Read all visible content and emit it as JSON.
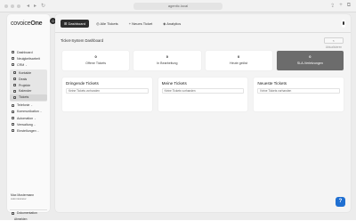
{
  "browser": {
    "url": "agentic.local",
    "nav_buttons": [
      "◂",
      "▸",
      "↻"
    ],
    "tool_buttons": [
      "⇪",
      "+",
      "⧉"
    ]
  },
  "app": {
    "logo_prefix": "co",
    "logo_middle": "voice",
    "logo_suffix": "One",
    "notification_count": "0"
  },
  "sidebar": {
    "items": [
      {
        "label": "Dashboard",
        "icon": "grid-icon"
      },
      {
        "label": "Neuigkeitsarbeit",
        "icon": "news-icon"
      },
      {
        "label": "CRM",
        "icon": "users-icon",
        "chevron": "⌄"
      }
    ],
    "crm_sub": [
      {
        "label": "Kontakte",
        "active": false
      },
      {
        "label": "Deals",
        "active": false
      },
      {
        "label": "Projekte",
        "active": false
      },
      {
        "label": "Kalender",
        "active": false
      },
      {
        "label": "Tickets",
        "active": true
      }
    ],
    "items2": [
      {
        "label": "Telefonie",
        "icon": "phone-icon",
        "chevron": "⌄"
      },
      {
        "label": "Kommunikation",
        "icon": "chat-icon",
        "chevron": "⌄"
      },
      {
        "label": "Automation",
        "icon": "bolt-icon",
        "chevron": "⌄"
      },
      {
        "label": "Verwaltung",
        "icon": "folder-icon",
        "chevron": "⌄"
      },
      {
        "label": "Einstellungen",
        "icon": "gear-icon",
        "chevron": "⌄"
      }
    ],
    "user_name": "Max Mustermann",
    "user_role": "Administrator",
    "doc_label": "Dokumentation",
    "logout_label": "Abmelden"
  },
  "tabs": [
    {
      "label": "Dashboard",
      "prefix": "⊞",
      "active": true
    },
    {
      "label": "Alle Tickets",
      "prefix": "◎",
      "active": false
    },
    {
      "label": "Neues Ticket",
      "prefix": "+",
      "active": false
    },
    {
      "label": "Analytics",
      "prefix": "◈",
      "active": false
    }
  ],
  "main": {
    "title": "Ticket-System Dashboard",
    "refresh_label": "↻ Aktualisieren",
    "cards": [
      {
        "value": "0",
        "label": "Offene Tickets",
        "dark": false
      },
      {
        "value": "0",
        "label": "In Bearbeitung",
        "dark": false
      },
      {
        "value": "0",
        "label": "Heute gelöst",
        "dark": false
      },
      {
        "value": "0",
        "label": "SLA-Verletzungen",
        "dark": true
      }
    ],
    "panels": [
      {
        "title": "Dringende Tickets",
        "empty": "Keine Tickets vorhanden"
      },
      {
        "title": "Meine Tickets",
        "empty": "Keine Tickets vorhanden"
      },
      {
        "title": "Neueste Tickets",
        "empty": "Keine Tickets vorhanden"
      }
    ]
  },
  "help_label": "?",
  "colors": {
    "accent": "#1f6fd1",
    "active_tab": "#2e2e2e",
    "sla_card": "#6c6c6c"
  }
}
